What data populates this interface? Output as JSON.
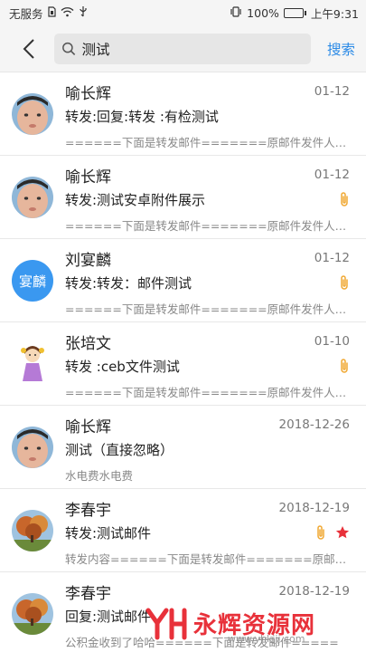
{
  "statusbar": {
    "carrier": "无服务",
    "battery": "100%",
    "battery_level": 1.0,
    "time": "上午9:31"
  },
  "search": {
    "query": "测试",
    "button_label": "搜索"
  },
  "colors": {
    "accent": "#2b8ae6",
    "attachment": "#f0a832",
    "star": "#e8313a",
    "avatar_blue": "#3a98f0"
  },
  "emails": [
    {
      "sender": "喻长辉",
      "date": "01-12",
      "subject": "转发:回复:转发 :有检测试",
      "preview": "======下面是转发邮件=======原邮件发件人名字...",
      "avatar": "photo-face",
      "attachment": false,
      "starred": false
    },
    {
      "sender": "喻长辉",
      "date": "01-12",
      "subject": "转发:测试安卓附件展示",
      "preview": "======下面是转发邮件=======原邮件发件人名字...",
      "avatar": "photo-face",
      "attachment": true,
      "starred": false
    },
    {
      "sender": "刘宴麟",
      "date": "01-12",
      "subject": "转发:转发：邮件测试",
      "preview": "======下面是转发邮件=======原邮件发件人名字...",
      "avatar": "text",
      "avatar_text": "宴麟",
      "attachment": true,
      "starred": false
    },
    {
      "sender": "张培文",
      "date": "01-10",
      "subject": "转发 :ceb文件测试",
      "preview": "======下面是转发邮件=======原邮件发件人名字...",
      "avatar": "cartoon-girl",
      "attachment": true,
      "starred": false
    },
    {
      "sender": "喻长辉",
      "date": "2018-12-26",
      "subject": "测试（直接忽略）",
      "preview": "水电费水电费",
      "avatar": "photo-face",
      "attachment": false,
      "starred": false
    },
    {
      "sender": "李春宇",
      "date": "2018-12-19",
      "subject": "转发:测试邮件",
      "preview": "转发内容======下面是转发邮件=======原邮件发...",
      "avatar": "photo-tree",
      "attachment": true,
      "starred": true
    },
    {
      "sender": "李春宇",
      "date": "2018-12-19",
      "subject": "回复:测试邮件",
      "preview": "公积金收到了哈哈======下面是转发邮件=====",
      "avatar": "photo-tree",
      "attachment": false,
      "starred": false
    }
  ],
  "watermark": {
    "text": "永辉资源网",
    "url": "www.yhkjjj.com"
  }
}
